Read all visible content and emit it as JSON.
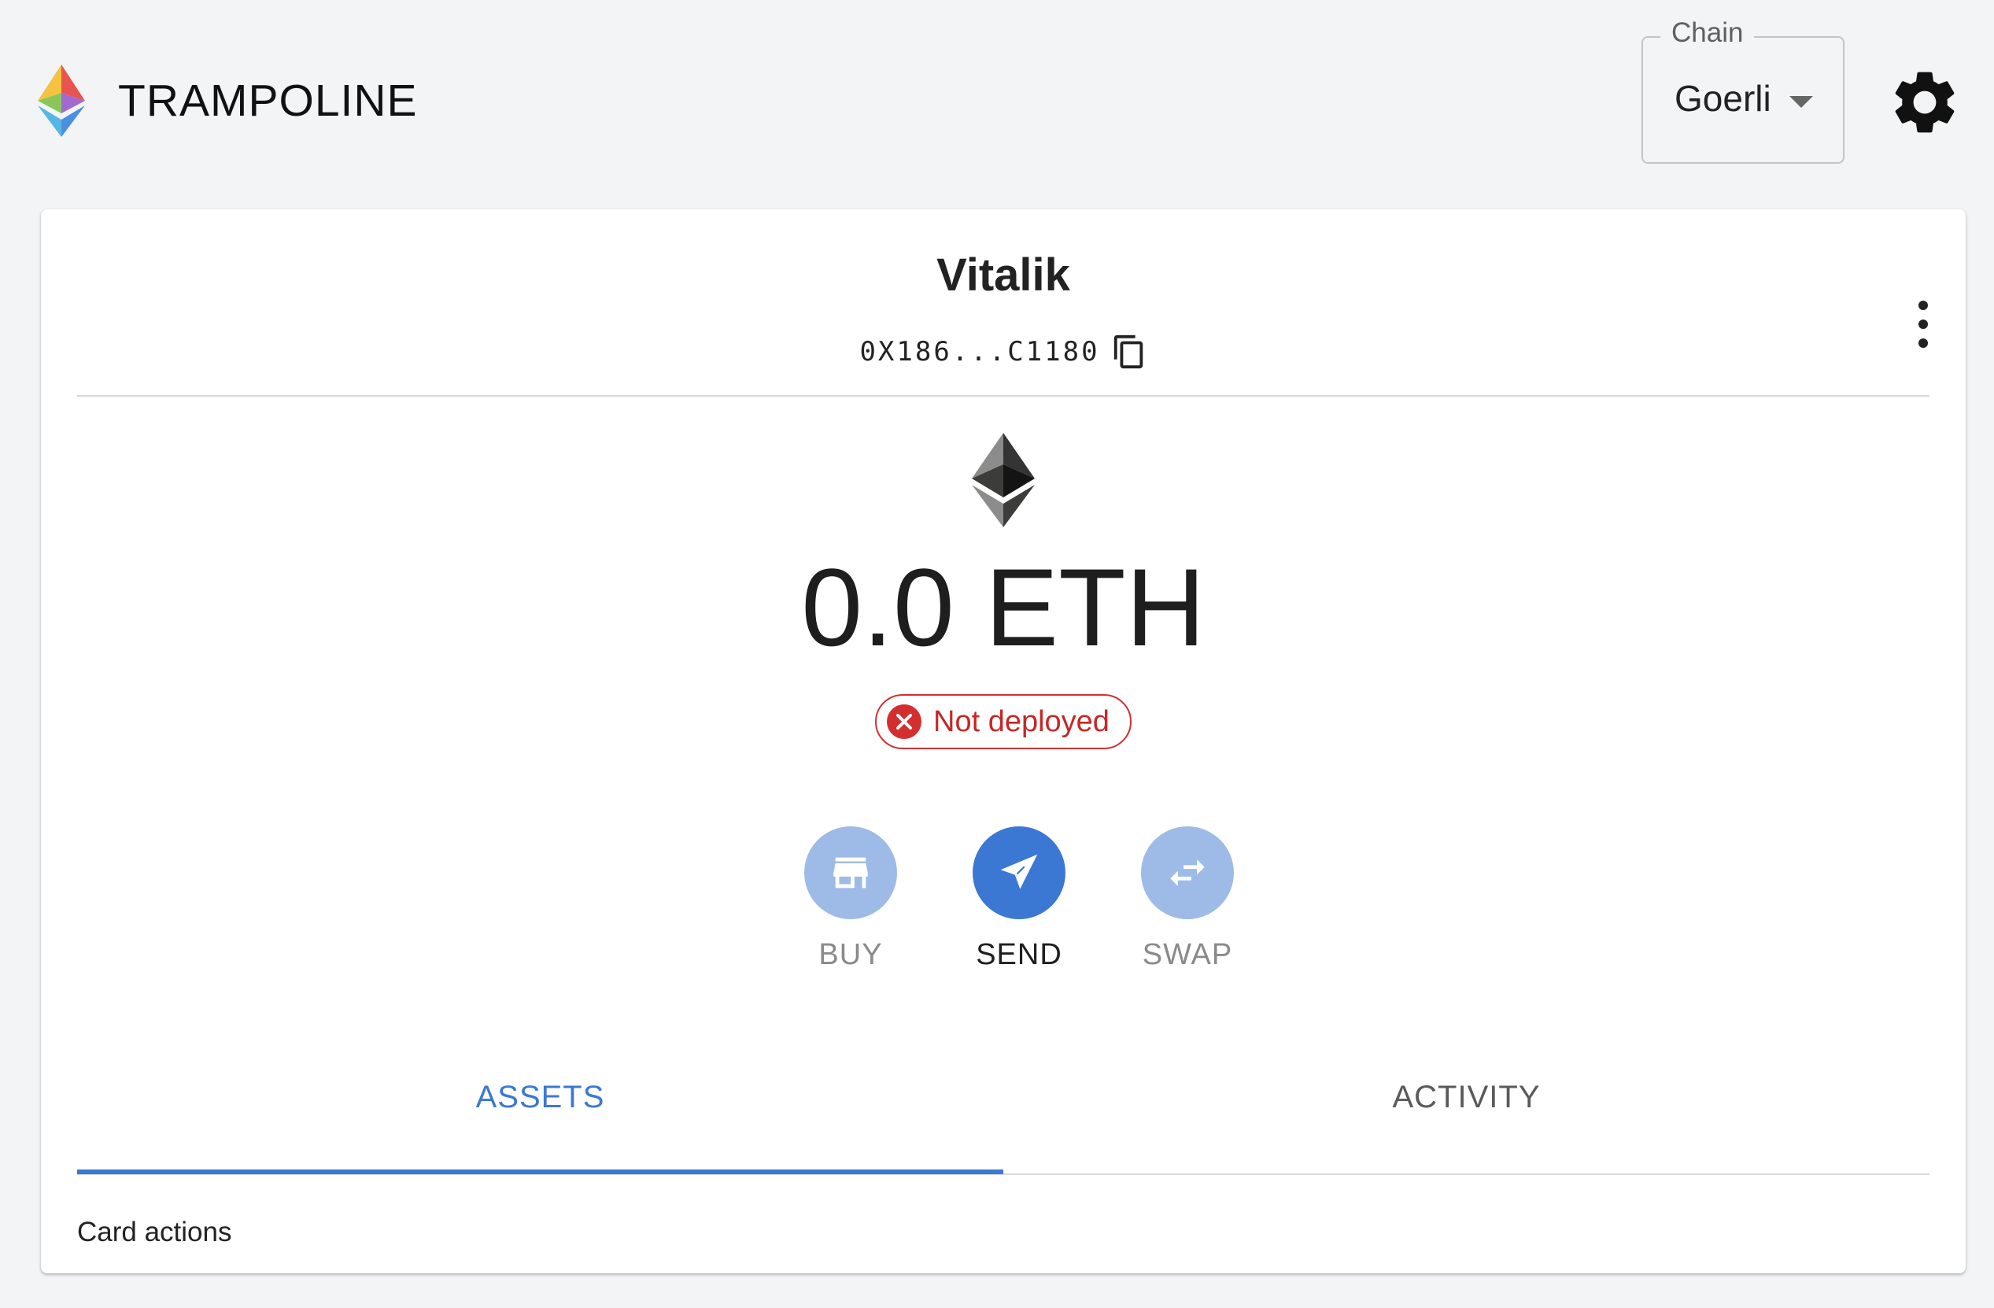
{
  "app": {
    "name": "TRAMPOLINE"
  },
  "chain": {
    "label": "Chain",
    "value": "Goerli"
  },
  "account": {
    "name": "Vitalik",
    "address": "0X186...C1180",
    "balance": "0.0 ETH",
    "status": "Not deployed"
  },
  "actions": [
    {
      "label": "BUY",
      "icon": "storefront-icon",
      "enabled": false
    },
    {
      "label": "SEND",
      "icon": "send-icon",
      "enabled": true
    },
    {
      "label": "SWAP",
      "icon": "swap-icon",
      "enabled": false
    }
  ],
  "tabs": [
    {
      "label": "ASSETS",
      "selected": true
    },
    {
      "label": "ACTIVITY",
      "selected": false
    }
  ],
  "footer": {
    "card_actions": "Card actions"
  },
  "colors": {
    "primary": "#3b78d3",
    "primary_light": "#9dbbe6",
    "error": "#d32f2f",
    "background": "#f3f4f6"
  }
}
